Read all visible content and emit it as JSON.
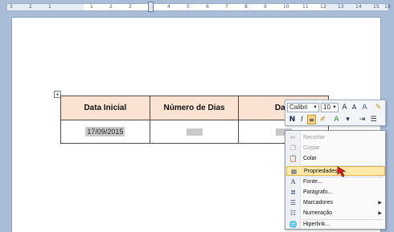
{
  "ruler": {
    "numbers": [
      "3",
      "2",
      "1",
      "1",
      "2",
      "3",
      "4",
      "5",
      "6",
      "7",
      "8",
      "9",
      "10",
      "11",
      "12",
      "13",
      "14",
      "15",
      "16"
    ]
  },
  "table": {
    "headers": [
      "Data Inicial",
      "Número de Dias",
      "Data"
    ],
    "row": [
      "17/09/2015",
      "",
      ""
    ]
  },
  "mini_toolbar": {
    "font": "Calibri",
    "size": "10",
    "buttons": [
      "grow-font",
      "shrink-font",
      "styles",
      "format-painter"
    ],
    "row2": [
      "N",
      "I",
      "align-center",
      "highlight",
      "font-color",
      "indent",
      "bullets"
    ]
  },
  "menu": {
    "items": [
      {
        "label": "Recortar",
        "icon": "scissors-icon",
        "enabled": false
      },
      {
        "label": "Copiar",
        "icon": "copy-icon",
        "enabled": false
      },
      {
        "label": "Colar",
        "icon": "paste-icon",
        "enabled": true
      },
      {
        "label": "Propriedades",
        "icon": "properties-icon",
        "enabled": true
      },
      {
        "label": "Fonte...",
        "icon": "font-icon",
        "enabled": true
      },
      {
        "label": "Parágrafo...",
        "icon": "paragraph-icon",
        "enabled": true
      },
      {
        "label": "Marcadores",
        "icon": "bullets-icon",
        "enabled": true
      },
      {
        "label": "Numeração",
        "icon": "numbering-icon",
        "enabled": true
      },
      {
        "label": "Hiperlink...",
        "icon": "hyperlink-icon",
        "enabled": true
      }
    ]
  },
  "colors": {
    "header_fill": "#fbe3d3",
    "highlight": "#fde9a9",
    "cursor": "#d91c1c"
  }
}
